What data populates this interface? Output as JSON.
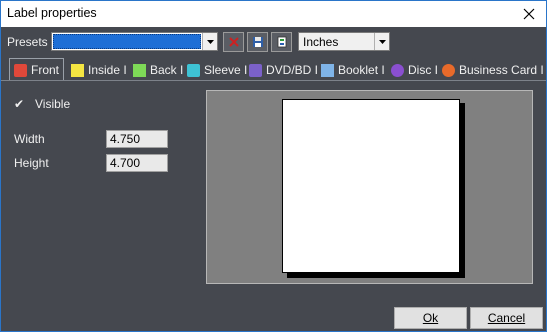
{
  "window": {
    "title": "Label properties"
  },
  "toolbar": {
    "presets_label": "Presets",
    "presets_value": "",
    "units_value": "Inches"
  },
  "tabs": [
    {
      "label": "Front",
      "icon": "disc-front-icon",
      "color": "#e0483a"
    },
    {
      "label": "Inside I",
      "icon": "inside-icon",
      "color": "#f5e642"
    },
    {
      "label": "Back I",
      "icon": "back-icon",
      "color": "#7ed957"
    },
    {
      "label": "Sleeve I",
      "icon": "sleeve-icon",
      "color": "#3ec3d5"
    },
    {
      "label": "DVD/BD I",
      "icon": "dvd-icon",
      "color": "#7b61c9"
    },
    {
      "label": "Booklet I",
      "icon": "booklet-icon",
      "color": "#7fb4e8"
    },
    {
      "label": "Disc I",
      "icon": "disc-icon",
      "color": "#8a4fd0"
    },
    {
      "label": "Business Card I",
      "icon": "business-card-icon",
      "color": "#e86a2a"
    }
  ],
  "properties": {
    "visible_label": "Visible",
    "visible_checked": true,
    "width_label": "Width",
    "width_value": "4.750",
    "height_label": "Height",
    "height_value": "4.700"
  },
  "buttons": {
    "ok": "Ok",
    "cancel": "Cancel"
  },
  "colors": {
    "background": "#45484f",
    "preview_bg": "#808080",
    "presets_selection": "#1f6fd6"
  }
}
